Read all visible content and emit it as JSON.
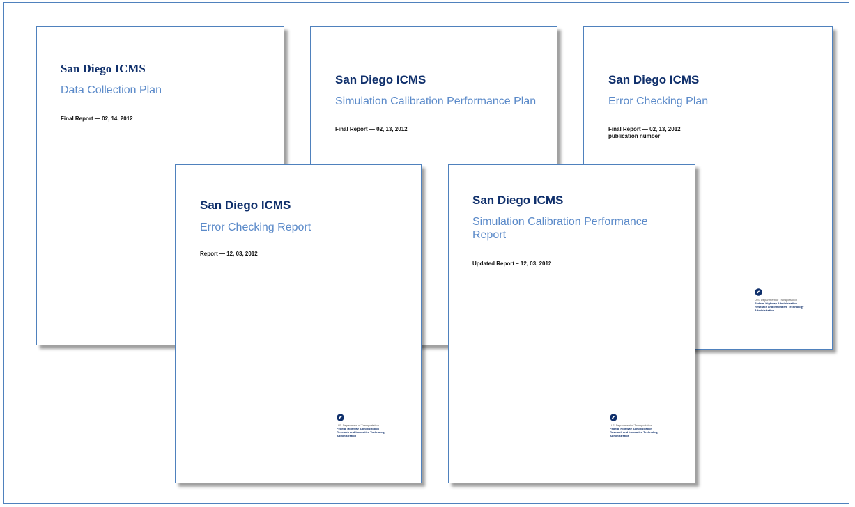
{
  "documents": [
    {
      "org": "San Diego ICMS",
      "title": "Data Collection Plan",
      "date_lines": [
        "Final Report — 02, 14, 2012"
      ]
    },
    {
      "org": "San Diego ICMS",
      "title": "Simulation Calibration Performance Plan",
      "date_lines": [
        "Final Report — 02, 13, 2012"
      ]
    },
    {
      "org": "San Diego ICMS",
      "title": "Error Checking Plan",
      "date_lines": [
        "Final Report — 02, 13, 2012",
        "publication number"
      ],
      "footer": {
        "department": "U.S. Department of Transportation",
        "agency_1": "Federal Highway Administration",
        "agency_2": "Research and Innovative Technology",
        "agency_3": "Administration"
      }
    },
    {
      "org": "San Diego ICMS",
      "title": "Error Checking Report",
      "date_lines": [
        "Report — 12, 03, 2012"
      ],
      "footer": {
        "department": "U.S. Department of Transportation",
        "agency_1": "Federal Highway Administration",
        "agency_2": "Research and Innovative Technology",
        "agency_3": "Administration"
      }
    },
    {
      "org": "San Diego ICMS",
      "title": "Simulation Calibration Performance Report",
      "date_lines": [
        "Updated Report – 12, 03, 2012"
      ],
      "footer": {
        "department": "U.S. Department of Transportation",
        "agency_1": "Federal Highway Administration",
        "agency_2": "Research and Innovative Technology",
        "agency_3": "Administration"
      }
    }
  ],
  "colors": {
    "frame_border": "#4f81bd",
    "org_text": "#0f2f6b",
    "title_text": "#5b8ac9"
  },
  "icons": {
    "dot_logo": "usdot-logo-icon"
  }
}
